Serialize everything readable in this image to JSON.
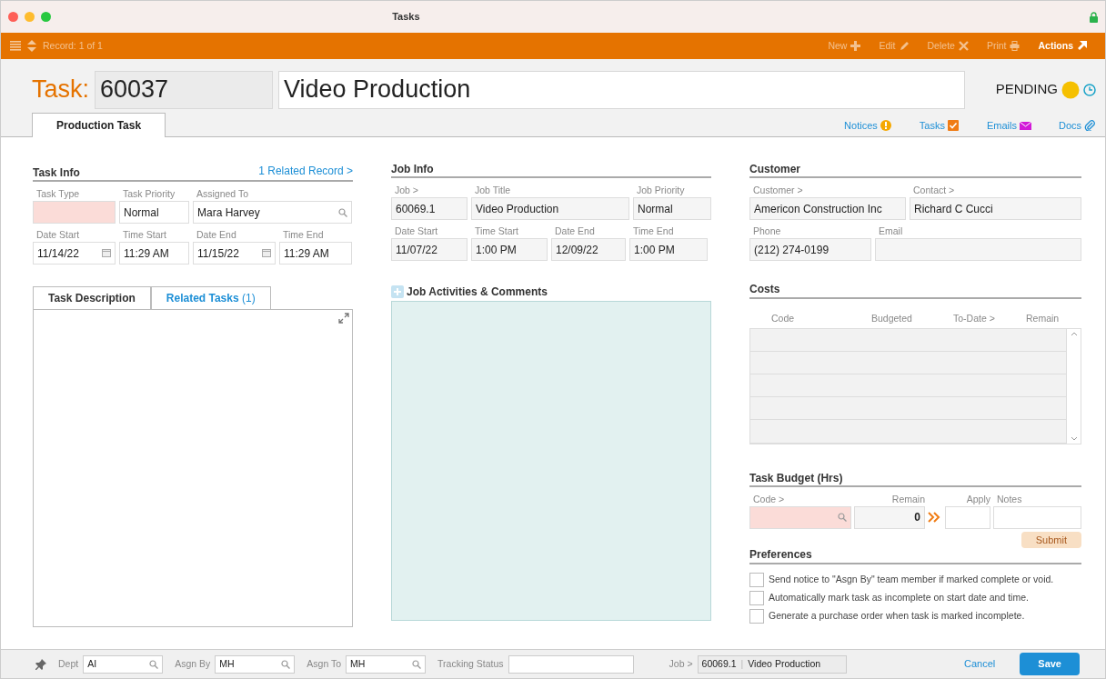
{
  "window": {
    "title": "Tasks"
  },
  "toolbar": {
    "record": "Record: 1 of 1",
    "actions": [
      {
        "label": "New",
        "kind": "new",
        "disabled": true
      },
      {
        "label": "Edit",
        "kind": "edit",
        "disabled": true
      },
      {
        "label": "Delete",
        "kind": "delete",
        "disabled": true
      },
      {
        "label": "Print",
        "kind": "print",
        "disabled": true
      },
      {
        "label": "Actions",
        "kind": "actions",
        "disabled": false
      }
    ]
  },
  "header": {
    "label": "Task:",
    "number": "60037",
    "title": "Video Production",
    "status": "PENDING"
  },
  "tabs": [
    {
      "label": "Production Task",
      "selected": true
    }
  ],
  "links": [
    {
      "label": "Notices",
      "kind": "notices"
    },
    {
      "label": "Tasks",
      "kind": "tasks"
    },
    {
      "label": "Emails",
      "kind": "emails"
    },
    {
      "label": "Docs",
      "kind": "docs"
    }
  ],
  "task_info": {
    "title": "Task Info",
    "link": "1 Related Record >",
    "fields": [
      {
        "label": "Task Type",
        "kind": "text",
        "required": true
      },
      {
        "label": "Task Priority",
        "value": "Normal",
        "kind": "text",
        "required": false
      },
      {
        "label": "Assigned To",
        "value": "Mara Harvey",
        "kind": "lookup",
        "required": false
      },
      {
        "label": "Date Start",
        "value": "11/14/22",
        "kind": "date",
        "required": false
      },
      {
        "label": "Time Start",
        "value": "11:29 AM",
        "kind": "text",
        "required": false
      },
      {
        "label": "Date End",
        "value": "11/15/22",
        "kind": "date",
        "required": false
      },
      {
        "label": "Time End",
        "value": "11:29 AM",
        "kind": "text",
        "required": false
      }
    ]
  },
  "description_tabs": [
    {
      "label": "Task Description",
      "selected": true
    },
    {
      "label": "Related Tasks",
      "count": "(1)",
      "selected": false
    }
  ],
  "job_info": {
    "title": "Job Info",
    "fields": [
      {
        "label": "Job >",
        "value": "60069.1"
      },
      {
        "label": "Job Title",
        "value": "Video Production"
      },
      {
        "label": "Job Priority",
        "value": "Normal"
      },
      {
        "label": "Date Start",
        "value": "11/07/22"
      },
      {
        "label": "Time Start",
        "value": "1:00 PM"
      },
      {
        "label": "Date End",
        "value": "12/09/22"
      },
      {
        "label": "Time End",
        "value": "1:00 PM"
      }
    ]
  },
  "activities": {
    "title": "Job Activities & Comments"
  },
  "customer": {
    "title": "Customer",
    "fields": [
      {
        "label": "Customer >",
        "value": "Americon Construction Inc"
      },
      {
        "label": "Contact >",
        "value": "Richard C Cucci"
      },
      {
        "label": "Phone",
        "value": "(212) 274-0199"
      },
      {
        "label": "Email"
      }
    ]
  },
  "costs": {
    "title": "Costs",
    "columns": [
      "Code",
      "Budgeted",
      "To-Date >",
      "Remain"
    ]
  },
  "task_budget": {
    "title": "Task Budget (Hrs)",
    "code_label": "Code >",
    "remain_label": "Remain",
    "apply_label": "Apply",
    "notes_label": "Notes",
    "remain": "0",
    "submit": {
      "label": "Submit",
      "disabled": true
    }
  },
  "preferences": {
    "title": "Preferences",
    "items": [
      {
        "label": "Send notice to \"Asgn By\" team member if marked complete or void.",
        "checked": false
      },
      {
        "label": "Automatically mark task as incomplete on start date and time.",
        "checked": false
      },
      {
        "label": "Generate a purchase order when task is marked incomplete.",
        "checked": false
      }
    ]
  },
  "footer": {
    "fields": [
      {
        "label": "Dept",
        "value": "AI"
      },
      {
        "label": "Asgn By",
        "value": "MH"
      },
      {
        "label": "Asgn To",
        "value": "MH"
      }
    ],
    "tracking_label": "Tracking Status",
    "job_label": "Job >",
    "job_number": "60069.1",
    "job_separator": "|",
    "job_title": "Video Production",
    "cancel": "Cancel",
    "save": "Save"
  }
}
